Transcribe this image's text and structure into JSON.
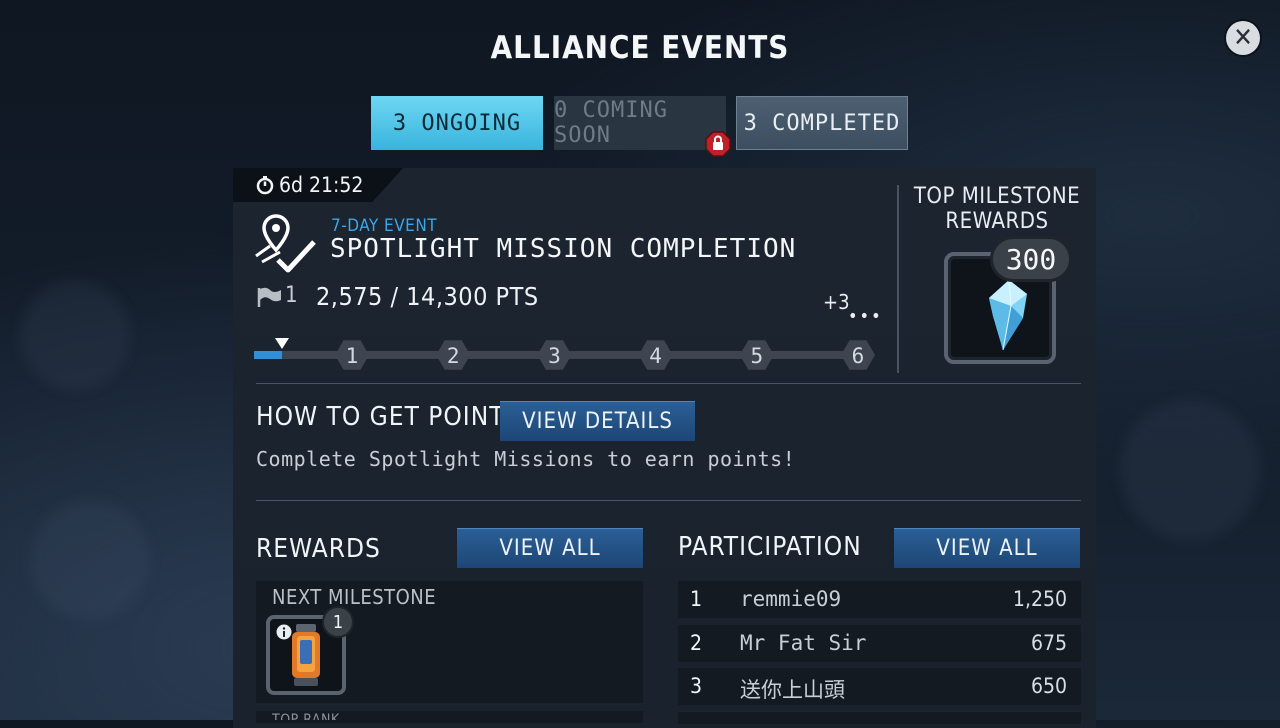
{
  "header": {
    "title": "ALLIANCE EVENTS",
    "close_icon": "close-icon"
  },
  "tabs": [
    {
      "label": "3 ONGOING",
      "state": "active"
    },
    {
      "label": "0 COMING SOON",
      "state": "locked",
      "icon": "lock-icon"
    },
    {
      "label": "3 COMPLETED",
      "state": "inactive"
    }
  ],
  "event": {
    "timer": "6d 21:52",
    "type": "7-DAY EVENT",
    "name": "SPOTLIGHT MISSION COMPLETION",
    "rank": "1",
    "points": "2,575 / 14,300 PTS",
    "plus_more": "+3",
    "progress_fraction": 0.18,
    "milestones": [
      "1",
      "2",
      "3",
      "4",
      "5",
      "6"
    ]
  },
  "top_milestone": {
    "title": "TOP MILESTONE REWARDS",
    "quantity": "300",
    "icon": "crystal-icon"
  },
  "how_to": {
    "title": "HOW TO GET POINTS",
    "button_label": "VIEW DETAILS",
    "description": "Complete Spotlight Missions to earn points!"
  },
  "rewards": {
    "title": "REWARDS",
    "view_all_label": "VIEW ALL",
    "next_milestone_label": "NEXT MILESTONE",
    "item_quantity": "1",
    "next_row_partial": "TOP RANK"
  },
  "participation": {
    "title": "PARTICIPATION",
    "view_all_label": "VIEW ALL",
    "rows": [
      {
        "rank": "1",
        "name": "remmie09",
        "score": "1,250"
      },
      {
        "rank": "2",
        "name": "Mr Fat Sir",
        "score": "675"
      },
      {
        "rank": "3",
        "name": "送你上山頭",
        "score": "650"
      }
    ]
  },
  "colors": {
    "accent_blue": "#3ba7e8",
    "tab_active": "#5ccbec",
    "button_blue": "#245487",
    "lock_red": "#c0202a"
  }
}
